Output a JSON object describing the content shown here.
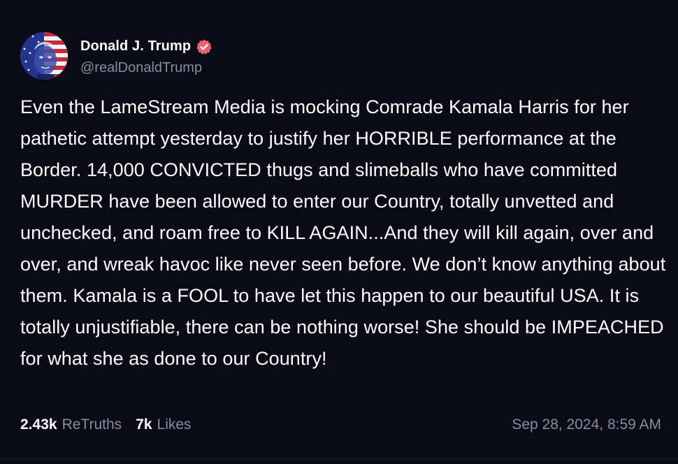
{
  "post": {
    "author": {
      "display_name": "Donald J. Trump",
      "handle": "@realDonaldTrump",
      "verified": true,
      "verified_icon": "verified-badge-icon",
      "verified_color": "#e8606e"
    },
    "text": "Even the LameStream Media is mocking Comrade Kamala Harris for her pathetic attempt yesterday to justify her HORRIBLE performance at the Border. 14,000 CONVICTED thugs and slimeballs who have committed MURDER have been allowed to enter our Country, totally unvetted and unchecked, and roam free to KILL AGAIN...And they will kill again, over and over, and wreak havoc like never seen before. We don’t know anything about them. Kamala is a FOOL to have let this happen to our beautiful USA. It is totally unjustifiable, there can be nothing worse! She should be IMPEACHED for what she as done to our Country!",
    "stats": {
      "retruths_count": "2.43k",
      "retruths_label": "ReTruths",
      "likes_count": "7k",
      "likes_label": "Likes"
    },
    "timestamp": "Sep 28, 2024, 8:59 AM"
  },
  "colors": {
    "background": "#0b0a17",
    "text": "#ffffff",
    "muted": "#8d8c9c"
  }
}
